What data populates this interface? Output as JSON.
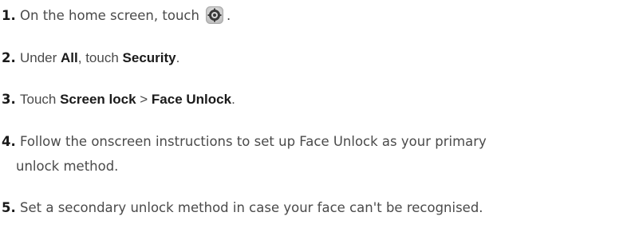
{
  "steps": [
    {
      "number": "1.",
      "text_before_icon": "On the home screen, touch",
      "icon": "settings-gear-icon",
      "text_after_icon": "."
    },
    {
      "number": "2.",
      "t1": "Under ",
      "b1": "All",
      "t2": ", touch ",
      "b2": "Security",
      "t3": "."
    },
    {
      "number": "3.",
      "t1": "Touch ",
      "b1": "Screen lock",
      "sep": " > ",
      "b2": "Face Unlock",
      "t2": "."
    },
    {
      "number": "4.",
      "line1": "Follow the onscreen instructions to set up Face Unlock as your primary",
      "line2": "unlock method."
    },
    {
      "number": "5.",
      "text": "Set a secondary unlock method in case your face can't be recognised."
    }
  ],
  "colors": {
    "text": "#4a4a4a",
    "bold_text": "#1a1a1a",
    "gear_dark": "#333333",
    "gear_light": "#c8c8c8"
  }
}
